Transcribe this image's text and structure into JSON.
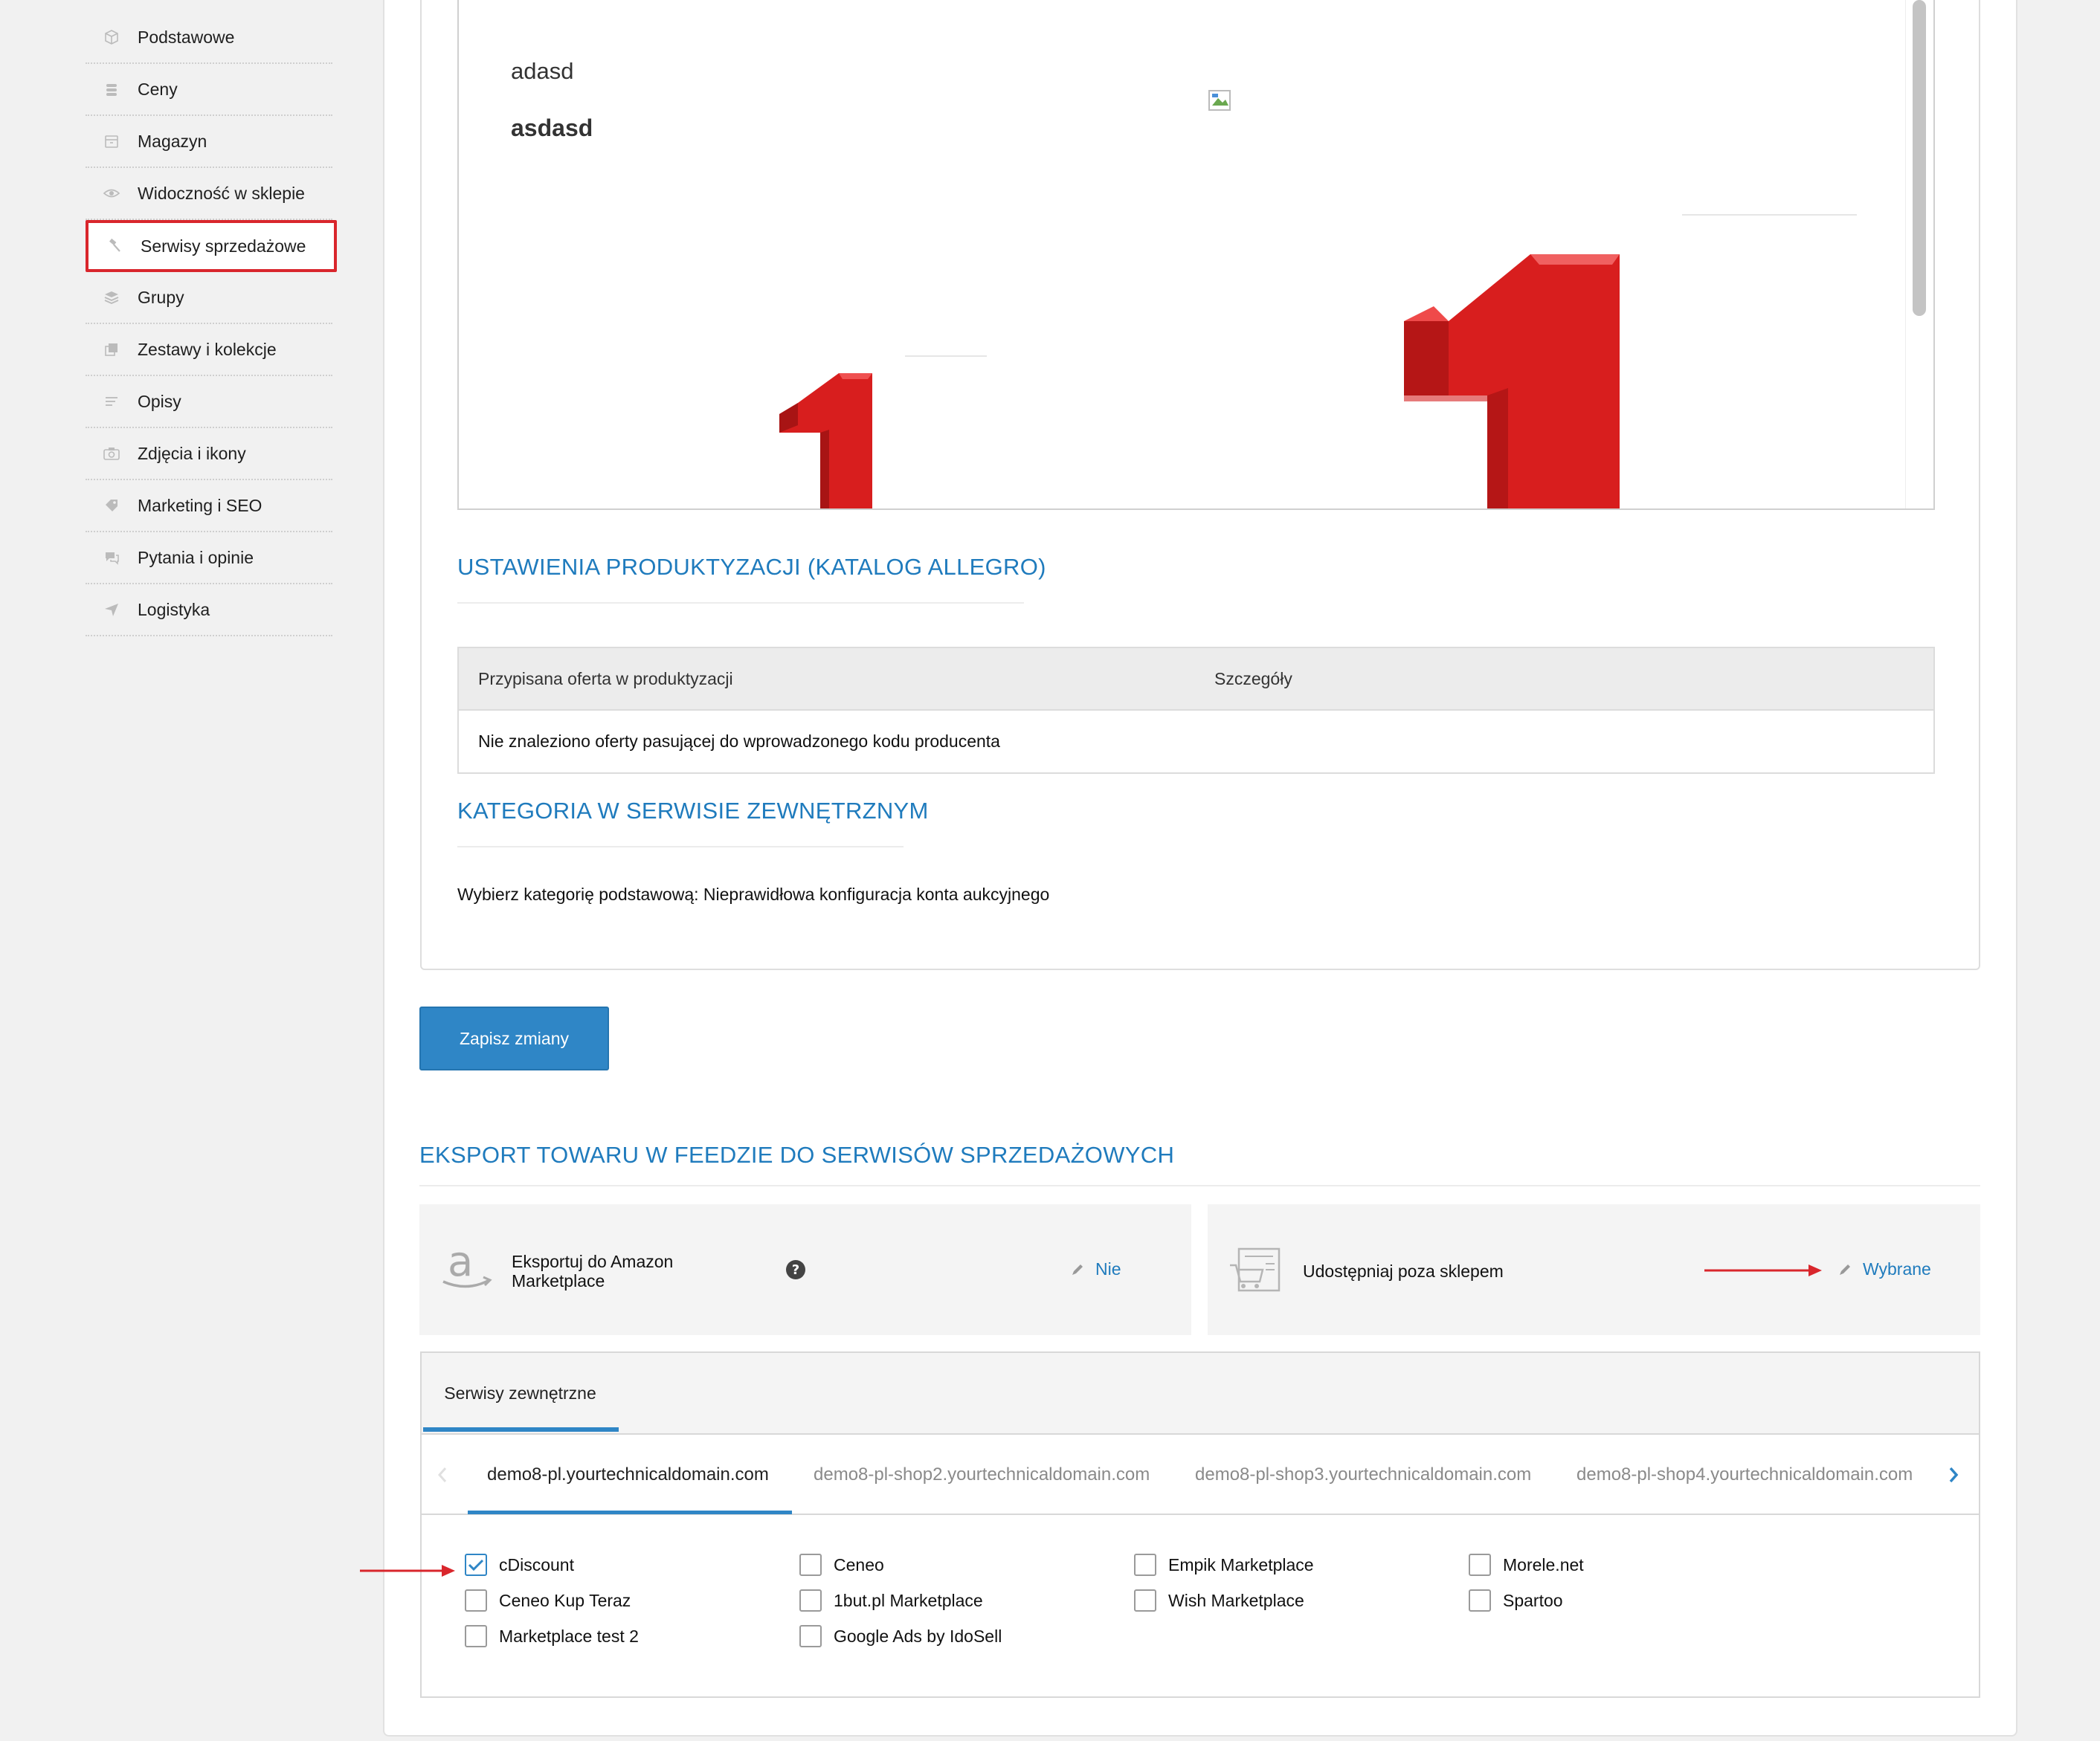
{
  "sidebar": {
    "items": [
      {
        "label": "Podstawowe",
        "icon": "box-icon"
      },
      {
        "label": "Ceny",
        "icon": "coins-icon"
      },
      {
        "label": "Magazyn",
        "icon": "archive-icon"
      },
      {
        "label": "Widoczność w sklepie",
        "icon": "eye-icon"
      },
      {
        "label": "Serwisy sprzedażowe",
        "icon": "gavel-icon"
      },
      {
        "label": "Grupy",
        "icon": "layers-icon"
      },
      {
        "label": "Zestawy i kolekcje",
        "icon": "stack-icon"
      },
      {
        "label": "Opisy",
        "icon": "text-lines-icon"
      },
      {
        "label": "Zdjęcia i ikony",
        "icon": "camera-icon"
      },
      {
        "label": "Marketing i SEO",
        "icon": "tag-icon"
      },
      {
        "label": "Pytania i opinie",
        "icon": "chat-icon"
      },
      {
        "label": "Logistyka",
        "icon": "send-icon"
      }
    ],
    "active_index": 4
  },
  "preview": {
    "line1": "adasd",
    "line2": "asdasd"
  },
  "productization": {
    "title": "USTAWIENIA PRODUKTYZACJI (KATALOG ALLEGRO)",
    "col1": "Przypisana oferta w produktyzacji",
    "col2": "Szczegóły",
    "empty_row": "Nie znaleziono oferty pasującej do wprowadzonego kodu producenta"
  },
  "category": {
    "title": "KATEGORIA W SERWISIE ZEWNĘTRZNYM",
    "text": "Wybierz kategorię podstawową: Nieprawidłowa konfiguracja konta aukcyjnego"
  },
  "save_button": "Zapisz zmiany",
  "export": {
    "title": "EKSPORT TOWARU W FEEDZIE DO SERWISÓW SPRZEDAŻOWYCH",
    "amazon_line1": "Eksportuj do Amazon",
    "amazon_line2": "Marketplace",
    "amazon_value": "Nie",
    "share_label": "Udostępniaj poza sklepem",
    "share_value": "Wybrane"
  },
  "external": {
    "tab_label": "Serwisy zewnętrzne",
    "domains": [
      "demo8-pl.yourtechnicaldomain.com",
      "demo8-pl-shop2.yourtechnicaldomain.com",
      "demo8-pl-shop3.yourtechnicaldomain.com",
      "demo8-pl-shop4.yourtechnicaldomain.com"
    ],
    "services": [
      {
        "label": "cDiscount",
        "checked": true
      },
      {
        "label": "Ceneo Kup Teraz",
        "checked": false
      },
      {
        "label": "Marketplace test 2",
        "checked": false
      },
      {
        "label": "Ceneo",
        "checked": false
      },
      {
        "label": "1but.pl Marketplace",
        "checked": false
      },
      {
        "label": "Google Ads by IdoSell",
        "checked": false
      },
      {
        "label": "Empik Marketplace",
        "checked": false
      },
      {
        "label": "Wish Marketplace",
        "checked": false
      },
      {
        "label": "Morele.net",
        "checked": false
      },
      {
        "label": "Spartoo",
        "checked": false
      }
    ]
  },
  "colors": {
    "accent": "#2f86c6",
    "heading": "#1f7bbd",
    "highlight": "#d9262c"
  }
}
